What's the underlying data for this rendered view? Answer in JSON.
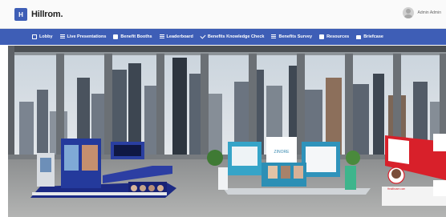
{
  "brand": {
    "name": "Hillrom.",
    "mark": "H"
  },
  "user": {
    "name": "Admin Admin"
  },
  "nav": {
    "items": [
      {
        "label": "Lobby",
        "icon": "lobby-icon"
      },
      {
        "label": "Live Presentations",
        "icon": "list-icon"
      },
      {
        "label": "Benefit Booths",
        "icon": "book-icon"
      },
      {
        "label": "Leaderboard",
        "icon": "list-icon"
      },
      {
        "label": "Benefits Knowledge Check",
        "icon": "check-icon"
      },
      {
        "label": "Benefits Survey",
        "icon": "list-icon"
      },
      {
        "label": "Resources",
        "icon": "book-icon"
      },
      {
        "label": "Briefcase",
        "icon": "briefcase-icon"
      }
    ]
  },
  "scene": {
    "booth_center_logo": "ZINORE",
    "booth_right_tag": "Healthcare.com"
  },
  "colors": {
    "nav": "#3e5eb6",
    "booth_dark": "#1c2a84",
    "booth_teal": "#36a4c8",
    "booth_red": "#d8202a"
  }
}
